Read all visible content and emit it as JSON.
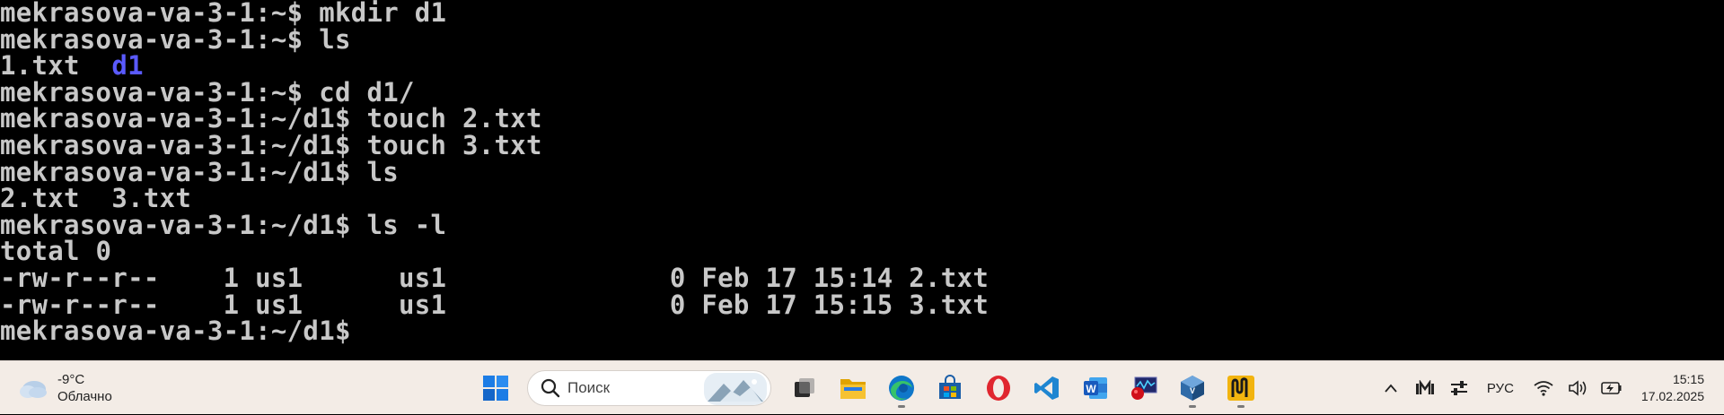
{
  "terminal": {
    "lines": [
      {
        "text": "mekrasova-va-3-1:~$ mkdir d1"
      },
      {
        "text": "mekrasova-va-3-1:~$ ls"
      },
      {
        "text": "1.txt  ",
        "dir": "d1"
      },
      {
        "text": "mekrasova-va-3-1:~$ cd d1/"
      },
      {
        "text": "mekrasova-va-3-1:~/d1$ touch 2.txt"
      },
      {
        "text": "mekrasova-va-3-1:~/d1$ touch 3.txt"
      },
      {
        "text": "mekrasova-va-3-1:~/d1$ ls"
      },
      {
        "text": "2.txt  3.txt"
      },
      {
        "text": "mekrasova-va-3-1:~/d1$ ls -l"
      },
      {
        "text": "total 0"
      },
      {
        "text": "-rw-r--r--    1 us1      us1              0 Feb 17 15:14 2.txt"
      },
      {
        "text": "-rw-r--r--    1 us1      us1              0 Feb 17 15:15 3.txt"
      },
      {
        "text": "mekrasova-va-3-1:~/d1$ "
      }
    ]
  },
  "taskbar": {
    "weather": {
      "temp": "-9°C",
      "condition": "Облачно",
      "icon": "cloud-icon"
    },
    "search": {
      "placeholder": "Поиск"
    },
    "apps": [
      {
        "name": "start-button",
        "icon": "windows-logo-icon"
      },
      {
        "name": "task-view-button",
        "icon": "task-view-icon"
      },
      {
        "name": "file-explorer-button",
        "icon": "folder-icon"
      },
      {
        "name": "edge-button",
        "icon": "edge-icon"
      },
      {
        "name": "store-button",
        "icon": "store-icon"
      },
      {
        "name": "opera-button",
        "icon": "opera-icon"
      },
      {
        "name": "vscode-button",
        "icon": "vscode-icon"
      },
      {
        "name": "word-button",
        "icon": "word-icon"
      },
      {
        "name": "monitor-app-button",
        "icon": "monitor-icon"
      },
      {
        "name": "virtualbox-button",
        "icon": "virtualbox-icon"
      },
      {
        "name": "app-button",
        "icon": "app-icon"
      }
    ],
    "tray": {
      "language": "РУС",
      "time": "15:15",
      "date": "17.02.2025"
    }
  }
}
